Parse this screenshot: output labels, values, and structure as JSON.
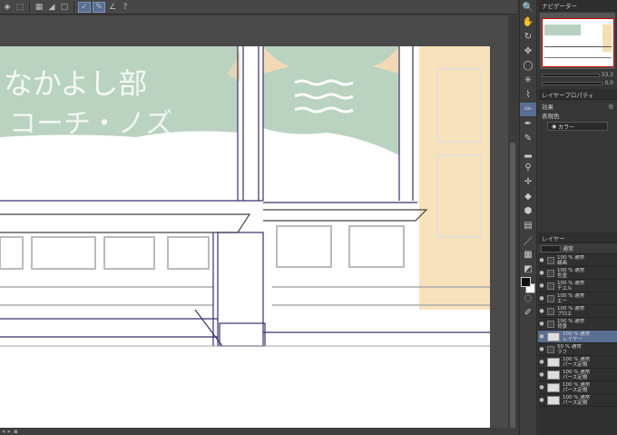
{
  "toolbar": {
    "icons": [
      "fill-icon",
      "select-icon",
      "grid-icon",
      "tone-icon",
      "square-icon",
      "pen-check-icon",
      "pen-edit-icon",
      "pen-line-icon",
      "help-icon"
    ],
    "glyphs": [
      "◈",
      "⬚",
      "▦",
      "◢",
      "▢",
      "✓",
      "✎",
      "∠",
      "?"
    ]
  },
  "canvas": {
    "chalkboard_text": "なかよし部",
    "chalkboard_text2": "コーチ・ノズ"
  },
  "tools": {
    "glyphs": [
      "🔍",
      "✋",
      "↻",
      "✥",
      "◯",
      "✳",
      "⌇",
      "✑",
      "✒",
      "✎",
      "▂",
      "⚲",
      "✛",
      "◆",
      "⬢",
      "▤",
      "／",
      "▦",
      "◩",
      "A",
      "◌",
      "✐",
      "▣",
      "✎"
    ]
  },
  "navigator": {
    "title": "ナビゲーター"
  },
  "sliders": {
    "zoom_value": "33.3",
    "angle_value": "0.0"
  },
  "layer_property": {
    "title": "レイヤープロパティ",
    "effects_label": "効果",
    "display_color_label": "表現色",
    "color_option": "カラー"
  },
  "layers": {
    "title": "レイヤー",
    "blend_mode": "通常",
    "rows": [
      {
        "name": "100 % 通常\n線画",
        "type": "folder"
      },
      {
        "name": "100 % 通常\n色塗",
        "type": "folder"
      },
      {
        "name": "100 % 通常\nチエル",
        "type": "folder"
      },
      {
        "name": "100 % 通常\nエー",
        "type": "folder"
      },
      {
        "name": "100 % 通常\nプロエ",
        "type": "folder"
      },
      {
        "name": "100 % 通常\n背景",
        "type": "folder"
      },
      {
        "name": "100 % 通常\nレイヤー",
        "type": "layer",
        "selected": true
      },
      {
        "name": "50 % 通常\nラフ",
        "type": "folder"
      },
      {
        "name": "100 % 通常\nパース定規",
        "type": "layer"
      },
      {
        "name": "100 % 通常\nパース定規",
        "type": "layer"
      },
      {
        "name": "100 % 通常\nパース定規",
        "type": "layer"
      },
      {
        "name": "100 % 通常\nパース定規",
        "type": "layer"
      }
    ]
  },
  "colors": {
    "accent": "#5a6e93",
    "chalkboard": "#a9c7b0",
    "door": "#f7ddb0"
  }
}
